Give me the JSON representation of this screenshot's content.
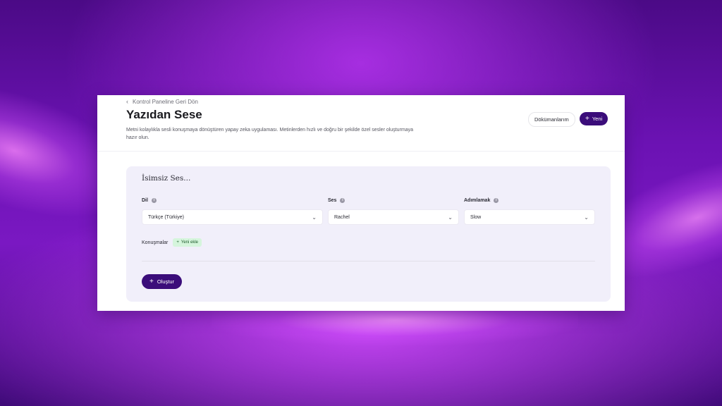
{
  "header": {
    "back_link": "Kontrol Paneline Geri Dön",
    "title": "Yazıdan Sese",
    "description": "Metni kolaylıkla sesli konuşmaya dönüştüren yapay zeka uygulaması. Metinlerden hızlı ve doğru bir şekilde özel sesler oluşturmaya hazır olun.",
    "docs_button": "Dökümanlarım",
    "new_button": "Yeni"
  },
  "form": {
    "title": "İsimsiz Ses...",
    "language": {
      "label": "Dil",
      "value": "Türkçe (Türkiye)"
    },
    "voice": {
      "label": "Ses",
      "value": "Rachel"
    },
    "pace": {
      "label": "Adımlamak",
      "value": "Slow"
    },
    "conversations_label": "Konuşmalar",
    "add_new": "Yeni ekle",
    "create_button": "Oluştur"
  },
  "icons": {
    "back": "chevron-left-icon",
    "plus": "plus-icon",
    "info": "info-icon",
    "dropdown": "chevron-down-icon"
  },
  "colors": {
    "accent": "#3b0d7a",
    "card_bg": "#f1effa",
    "chip_bg": "#d5f5dc",
    "page_bg": "#6b12b3"
  }
}
